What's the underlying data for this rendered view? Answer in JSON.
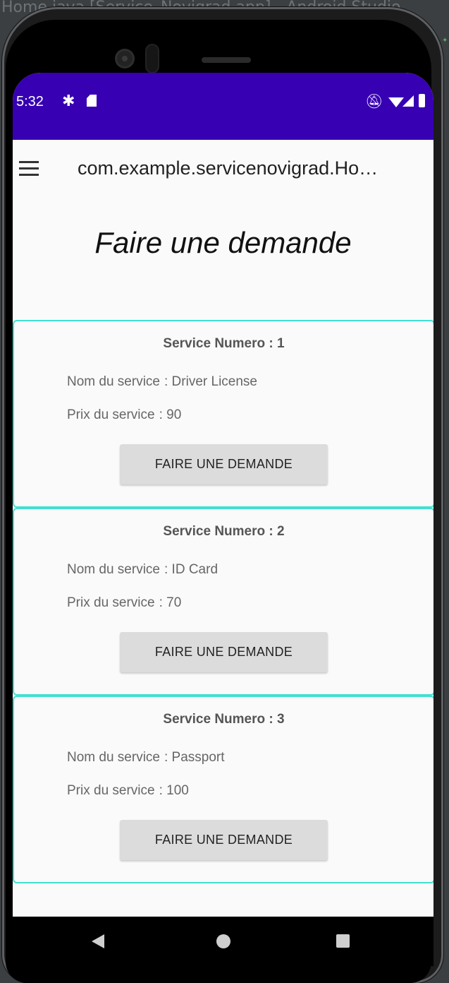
{
  "ide": {
    "window_title": "Home.java [Service_Novigrad.app] - Android Studio"
  },
  "status_bar": {
    "time": "5:32",
    "icons": [
      "gear-icon",
      "sd-card-icon",
      "mute-icon",
      "wifi-icon",
      "signal-icon",
      "battery-icon"
    ]
  },
  "toolbar": {
    "title": "com.example.servicenovigrad.Ho…",
    "menu_icon": "hamburger-menu-icon"
  },
  "page": {
    "heading": "Faire une demande"
  },
  "services": [
    {
      "title": "Service Numero : 1",
      "name_label": "Nom du service",
      "name_value": ": Driver License",
      "price_label": "Prix du service",
      "price_value": ": 90",
      "button_label": "FAIRE UNE DEMANDE"
    },
    {
      "title": "Service Numero : 2",
      "name_label": "Nom du service",
      "name_value": ": ID Card",
      "price_label": "Prix du service",
      "price_value": ": 70",
      "button_label": "FAIRE UNE DEMANDE"
    },
    {
      "title": "Service Numero : 3",
      "name_label": "Nom du service",
      "name_value": ": Passport",
      "price_label": "Prix du service",
      "price_value": ": 100",
      "button_label": "FAIRE UNE DEMANDE"
    }
  ],
  "colors": {
    "status_bar": "#3700b3",
    "card_border": "#40e0d0",
    "button_bg": "#dcdcdc",
    "screen_bg": "#fafafa"
  },
  "nav_bar": {
    "icons": [
      "back-icon",
      "home-icon",
      "recents-icon"
    ]
  }
}
